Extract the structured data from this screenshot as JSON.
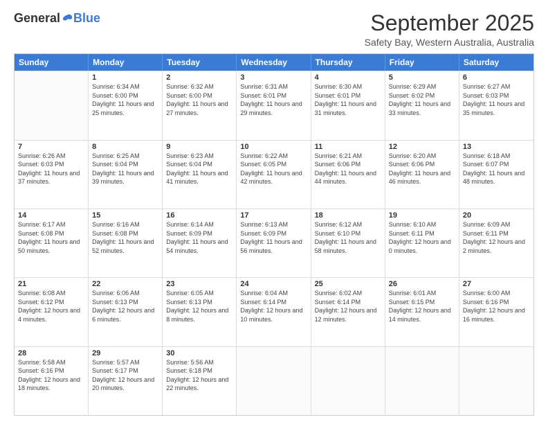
{
  "logo": {
    "general": "General",
    "blue": "Blue"
  },
  "title": "September 2025",
  "subtitle": "Safety Bay, Western Australia, Australia",
  "days": [
    "Sunday",
    "Monday",
    "Tuesday",
    "Wednesday",
    "Thursday",
    "Friday",
    "Saturday"
  ],
  "rows": [
    [
      {
        "day": "",
        "empty": true
      },
      {
        "day": "1",
        "sunrise": "6:34 AM",
        "sunset": "6:00 PM",
        "daylight": "Daylight: 11 hours and 25 minutes."
      },
      {
        "day": "2",
        "sunrise": "6:32 AM",
        "sunset": "6:00 PM",
        "daylight": "Daylight: 11 hours and 27 minutes."
      },
      {
        "day": "3",
        "sunrise": "6:31 AM",
        "sunset": "6:01 PM",
        "daylight": "Daylight: 11 hours and 29 minutes."
      },
      {
        "day": "4",
        "sunrise": "6:30 AM",
        "sunset": "6:01 PM",
        "daylight": "Daylight: 11 hours and 31 minutes."
      },
      {
        "day": "5",
        "sunrise": "6:29 AM",
        "sunset": "6:02 PM",
        "daylight": "Daylight: 11 hours and 33 minutes."
      },
      {
        "day": "6",
        "sunrise": "6:27 AM",
        "sunset": "6:03 PM",
        "daylight": "Daylight: 11 hours and 35 minutes."
      }
    ],
    [
      {
        "day": "7",
        "sunrise": "6:26 AM",
        "sunset": "6:03 PM",
        "daylight": "Daylight: 11 hours and 37 minutes."
      },
      {
        "day": "8",
        "sunrise": "6:25 AM",
        "sunset": "6:04 PM",
        "daylight": "Daylight: 11 hours and 39 minutes."
      },
      {
        "day": "9",
        "sunrise": "6:23 AM",
        "sunset": "6:04 PM",
        "daylight": "Daylight: 11 hours and 41 minutes."
      },
      {
        "day": "10",
        "sunrise": "6:22 AM",
        "sunset": "6:05 PM",
        "daylight": "Daylight: 11 hours and 42 minutes."
      },
      {
        "day": "11",
        "sunrise": "6:21 AM",
        "sunset": "6:06 PM",
        "daylight": "Daylight: 11 hours and 44 minutes."
      },
      {
        "day": "12",
        "sunrise": "6:20 AM",
        "sunset": "6:06 PM",
        "daylight": "Daylight: 11 hours and 46 minutes."
      },
      {
        "day": "13",
        "sunrise": "6:18 AM",
        "sunset": "6:07 PM",
        "daylight": "Daylight: 11 hours and 48 minutes."
      }
    ],
    [
      {
        "day": "14",
        "sunrise": "6:17 AM",
        "sunset": "6:08 PM",
        "daylight": "Daylight: 11 hours and 50 minutes."
      },
      {
        "day": "15",
        "sunrise": "6:16 AM",
        "sunset": "6:08 PM",
        "daylight": "Daylight: 11 hours and 52 minutes."
      },
      {
        "day": "16",
        "sunrise": "6:14 AM",
        "sunset": "6:09 PM",
        "daylight": "Daylight: 11 hours and 54 minutes."
      },
      {
        "day": "17",
        "sunrise": "6:13 AM",
        "sunset": "6:09 PM",
        "daylight": "Daylight: 11 hours and 56 minutes."
      },
      {
        "day": "18",
        "sunrise": "6:12 AM",
        "sunset": "6:10 PM",
        "daylight": "Daylight: 11 hours and 58 minutes."
      },
      {
        "day": "19",
        "sunrise": "6:10 AM",
        "sunset": "6:11 PM",
        "daylight": "Daylight: 12 hours and 0 minutes."
      },
      {
        "day": "20",
        "sunrise": "6:09 AM",
        "sunset": "6:11 PM",
        "daylight": "Daylight: 12 hours and 2 minutes."
      }
    ],
    [
      {
        "day": "21",
        "sunrise": "6:08 AM",
        "sunset": "6:12 PM",
        "daylight": "Daylight: 12 hours and 4 minutes."
      },
      {
        "day": "22",
        "sunrise": "6:06 AM",
        "sunset": "6:13 PM",
        "daylight": "Daylight: 12 hours and 6 minutes."
      },
      {
        "day": "23",
        "sunrise": "6:05 AM",
        "sunset": "6:13 PM",
        "daylight": "Daylight: 12 hours and 8 minutes."
      },
      {
        "day": "24",
        "sunrise": "6:04 AM",
        "sunset": "6:14 PM",
        "daylight": "Daylight: 12 hours and 10 minutes."
      },
      {
        "day": "25",
        "sunrise": "6:02 AM",
        "sunset": "6:14 PM",
        "daylight": "Daylight: 12 hours and 12 minutes."
      },
      {
        "day": "26",
        "sunrise": "6:01 AM",
        "sunset": "6:15 PM",
        "daylight": "Daylight: 12 hours and 14 minutes."
      },
      {
        "day": "27",
        "sunrise": "6:00 AM",
        "sunset": "6:16 PM",
        "daylight": "Daylight: 12 hours and 16 minutes."
      }
    ],
    [
      {
        "day": "28",
        "sunrise": "5:58 AM",
        "sunset": "6:16 PM",
        "daylight": "Daylight: 12 hours and 18 minutes."
      },
      {
        "day": "29",
        "sunrise": "5:57 AM",
        "sunset": "6:17 PM",
        "daylight": "Daylight: 12 hours and 20 minutes."
      },
      {
        "day": "30",
        "sunrise": "5:56 AM",
        "sunset": "6:18 PM",
        "daylight": "Daylight: 12 hours and 22 minutes."
      },
      {
        "day": "",
        "empty": true
      },
      {
        "day": "",
        "empty": true
      },
      {
        "day": "",
        "empty": true
      },
      {
        "day": "",
        "empty": true
      }
    ]
  ]
}
